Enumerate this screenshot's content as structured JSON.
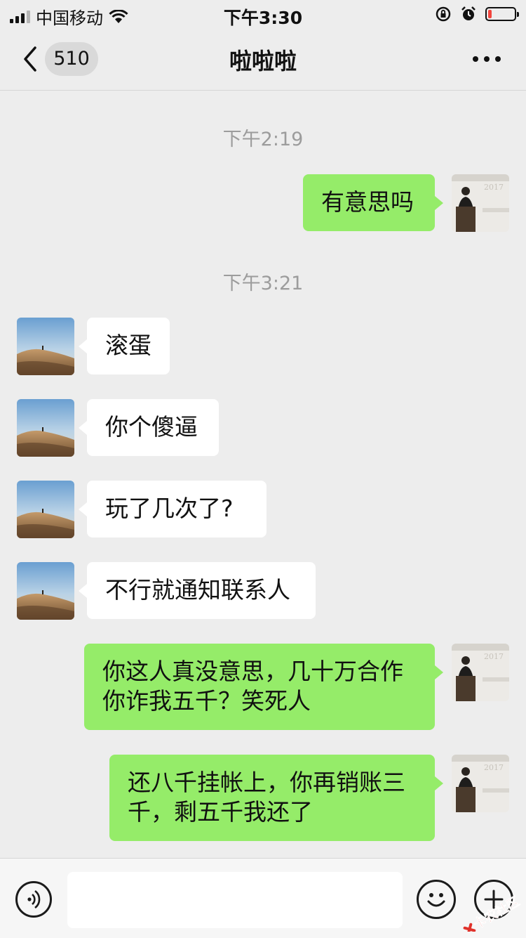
{
  "status_bar": {
    "carrier": "中国移动",
    "time": "下午3:30",
    "battery_level": 0.15,
    "battery_color": "#f2453d"
  },
  "nav": {
    "back_icon": "chevron-left-icon",
    "unread_count": "510",
    "title": "啦啦啦",
    "more_icon": "ellipsis-icon"
  },
  "messages": {
    "ts1": "下午2:19",
    "m1": "有意思吗",
    "ts2": "下午3:21",
    "m2": "滚蛋",
    "m3": "你个傻逼",
    "m4": "玩了几次了?",
    "m5": "不行就通知联系人",
    "m6": "你这人真没意思，几十万合作你诈我五千？笑死人",
    "m7": "还八千挂帐上，你再销账三千，剩五千我还了"
  },
  "avatar_labels": {
    "self_year": "2017"
  },
  "input_bar": {
    "value": "",
    "voice_icon": "voice-icon",
    "emoji_icon": "emoji-icon",
    "plus_icon": "plus-icon"
  },
  "watermark": {
    "text": "卡农社区"
  },
  "colors": {
    "self_bubble": "#95ec69",
    "other_bubble": "#ffffff",
    "background": "#ededed"
  }
}
